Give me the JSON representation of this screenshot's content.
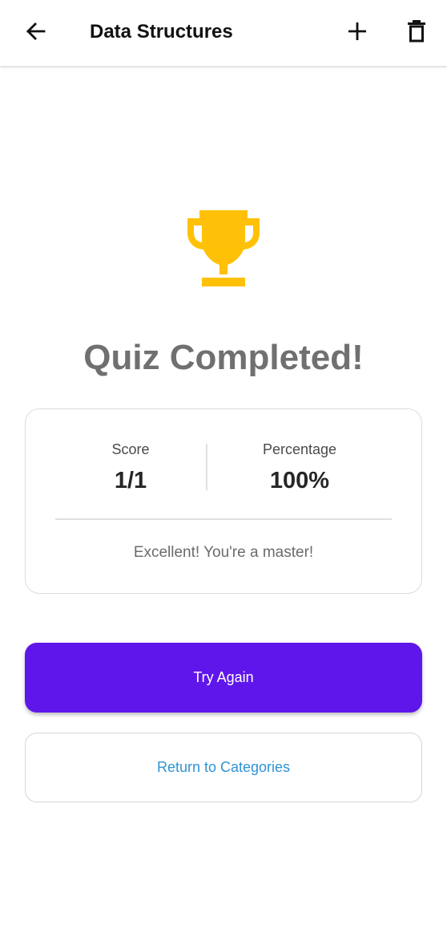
{
  "app_bar": {
    "title": "Data Structures",
    "back_icon": "arrow-left-icon",
    "add_icon": "plus-icon",
    "delete_icon": "trash-icon"
  },
  "result": {
    "icon": "trophy-icon",
    "icon_color": "#FFC107",
    "headline": "Quiz Completed!",
    "score_label": "Score",
    "score_value": "1/1",
    "percentage_label": "Percentage",
    "percentage_value": "100%",
    "message": "Excellent! You're a master!"
  },
  "actions": {
    "try_again_label": "Try Again",
    "return_label": "Return to Categories",
    "primary_color": "#5F16EA",
    "link_color": "#2F93D4"
  }
}
